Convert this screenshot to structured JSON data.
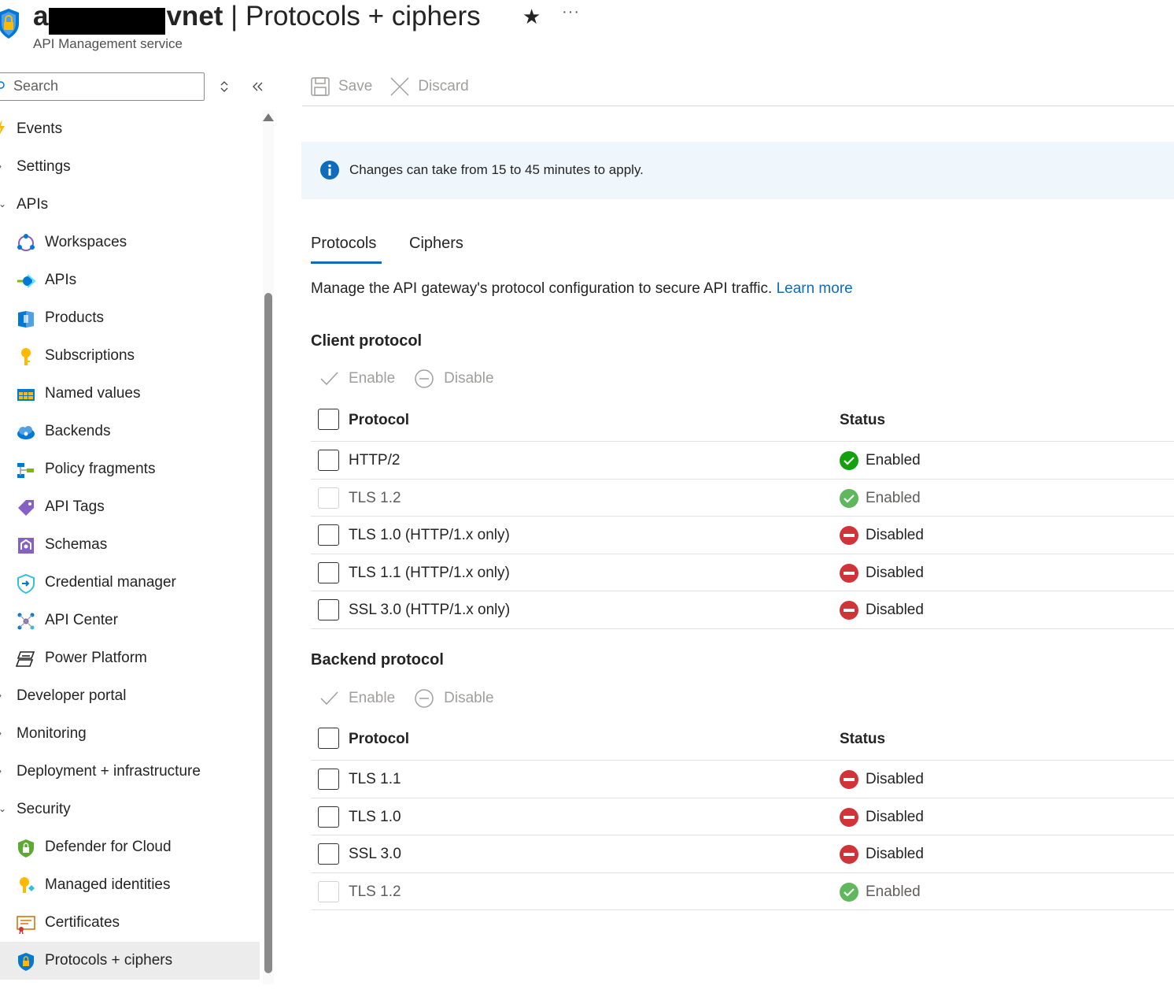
{
  "header": {
    "title_prefix": "a",
    "title_suffix": "vnet",
    "title_separator": " | ",
    "page": "Protocols + ciphers",
    "subtitle": "API Management service",
    "more": "···"
  },
  "sidebar": {
    "search_placeholder": "Search",
    "items": [
      {
        "label": "Events",
        "type": "group",
        "icon": "lightning-icon"
      },
      {
        "label": "Settings",
        "type": "group"
      },
      {
        "label": "APIs",
        "type": "group",
        "expanded": true
      },
      {
        "label": "Workspaces",
        "type": "child",
        "icon": "workspaces-icon"
      },
      {
        "label": "APIs",
        "type": "child",
        "icon": "apis-icon"
      },
      {
        "label": "Products",
        "type": "child",
        "icon": "products-icon"
      },
      {
        "label": "Subscriptions",
        "type": "child",
        "icon": "key-icon"
      },
      {
        "label": "Named values",
        "type": "child",
        "icon": "named-values-icon"
      },
      {
        "label": "Backends",
        "type": "child",
        "icon": "backends-icon"
      },
      {
        "label": "Policy fragments",
        "type": "child",
        "icon": "policy-fragments-icon"
      },
      {
        "label": "API Tags",
        "type": "child",
        "icon": "tag-icon"
      },
      {
        "label": "Schemas",
        "type": "child",
        "icon": "schemas-icon"
      },
      {
        "label": "Credential manager",
        "type": "child",
        "icon": "credential-icon"
      },
      {
        "label": "API Center",
        "type": "child",
        "icon": "api-center-icon"
      },
      {
        "label": "Power Platform",
        "type": "child",
        "icon": "power-platform-icon"
      },
      {
        "label": "Developer portal",
        "type": "group"
      },
      {
        "label": "Monitoring",
        "type": "group"
      },
      {
        "label": "Deployment + infrastructure",
        "type": "group"
      },
      {
        "label": "Security",
        "type": "group",
        "expanded": true
      },
      {
        "label": "Defender for Cloud",
        "type": "child",
        "icon": "defender-icon"
      },
      {
        "label": "Managed identities",
        "type": "child",
        "icon": "managed-identity-icon"
      },
      {
        "label": "Certificates",
        "type": "child",
        "icon": "certificate-icon"
      },
      {
        "label": "Protocols + ciphers",
        "type": "child",
        "icon": "shield-lock-icon",
        "active": true
      }
    ]
  },
  "toolbar": {
    "save": "Save",
    "discard": "Discard"
  },
  "info": {
    "text": "Changes can take from 15 to 45 minutes to apply."
  },
  "tabs": [
    {
      "label": "Protocols",
      "active": true
    },
    {
      "label": "Ciphers",
      "active": false
    }
  ],
  "description": {
    "text": "Manage the API gateway's protocol configuration to secure API traffic. ",
    "link": "Learn more"
  },
  "client": {
    "title": "Client protocol",
    "enable": "Enable",
    "disable": "Disable",
    "col_protocol": "Protocol",
    "col_status": "Status",
    "rows": [
      {
        "protocol": "HTTP/2",
        "status": "Enabled",
        "enabled": true,
        "locked": false
      },
      {
        "protocol": "TLS 1.2",
        "status": "Enabled",
        "enabled": true,
        "locked": true
      },
      {
        "protocol": "TLS 1.0 (HTTP/1.x only)",
        "status": "Disabled",
        "enabled": false,
        "locked": false
      },
      {
        "protocol": "TLS 1.1 (HTTP/1.x only)",
        "status": "Disabled",
        "enabled": false,
        "locked": false
      },
      {
        "protocol": "SSL 3.0 (HTTP/1.x only)",
        "status": "Disabled",
        "enabled": false,
        "locked": false
      }
    ]
  },
  "backend": {
    "title": "Backend protocol",
    "enable": "Enable",
    "disable": "Disable",
    "col_protocol": "Protocol",
    "col_status": "Status",
    "rows": [
      {
        "protocol": "TLS 1.1",
        "status": "Disabled",
        "enabled": false,
        "locked": false
      },
      {
        "protocol": "TLS 1.0",
        "status": "Disabled",
        "enabled": false,
        "locked": false
      },
      {
        "protocol": "SSL 3.0",
        "status": "Disabled",
        "enabled": false,
        "locked": false
      },
      {
        "protocol": "TLS 1.2",
        "status": "Enabled",
        "enabled": true,
        "locked": true
      }
    ]
  },
  "colors": {
    "accent": "#0f6cbd",
    "enabled_green": "#13a10e",
    "disabled_red": "#d13438",
    "info_bg": "#eff6fc"
  }
}
